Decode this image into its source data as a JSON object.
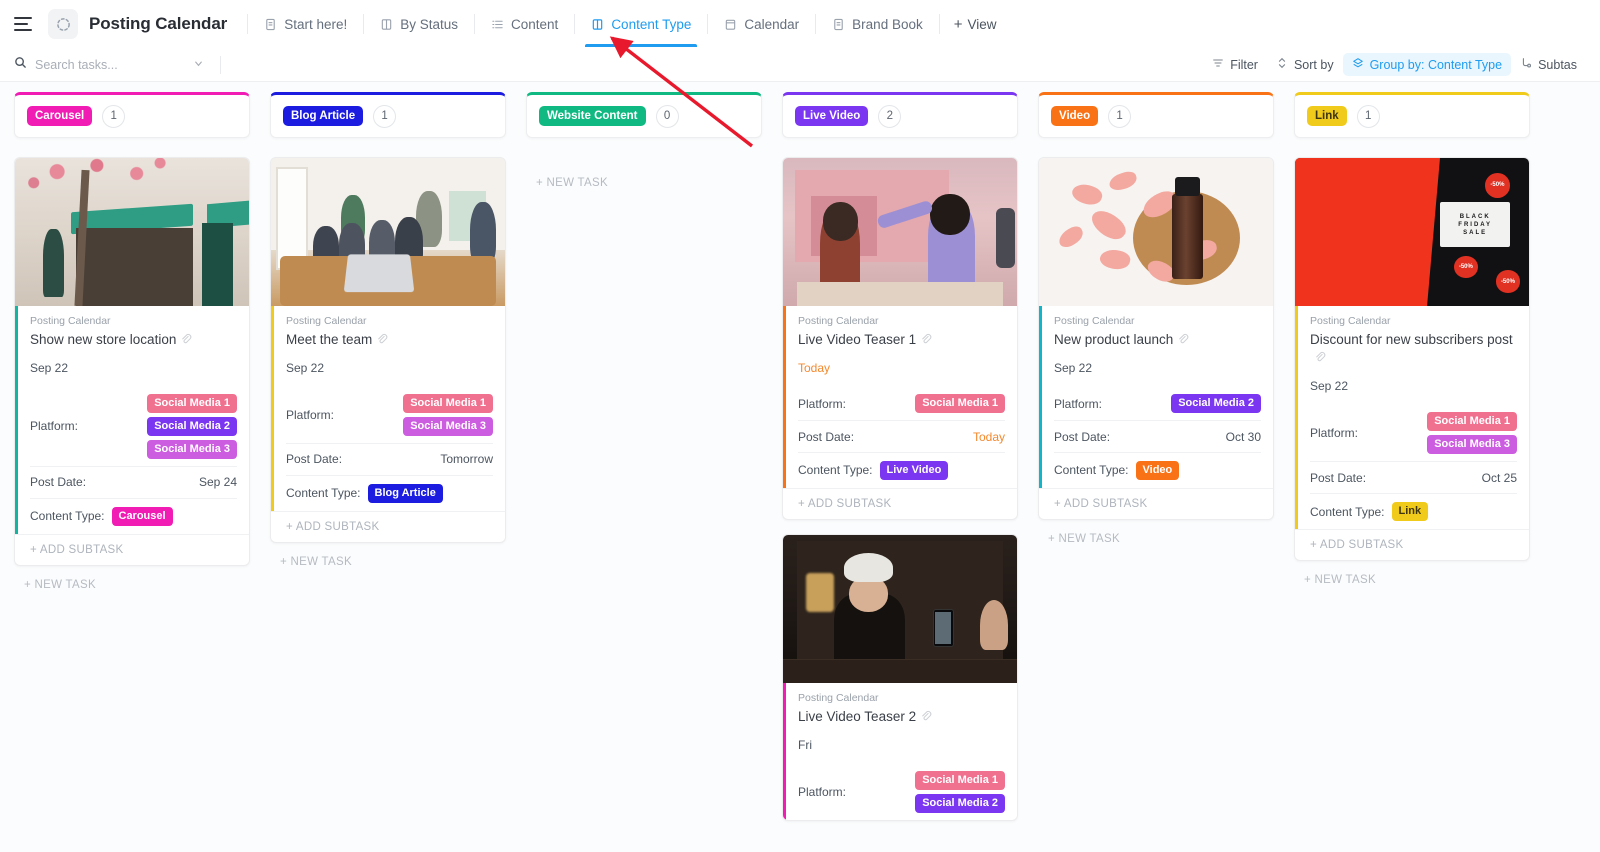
{
  "topbar": {
    "app_title": "Posting Calendar",
    "tabs": [
      {
        "label": "Start here!",
        "icon": "doc-icon",
        "active": false
      },
      {
        "label": "By Status",
        "icon": "board-icon",
        "active": false
      },
      {
        "label": "Content",
        "icon": "list-icon",
        "active": false
      },
      {
        "label": "Content Type",
        "icon": "board-icon",
        "active": true
      },
      {
        "label": "Calendar",
        "icon": "calendar-icon",
        "active": false
      },
      {
        "label": "Brand Book",
        "icon": "doc-icon",
        "active": false
      }
    ],
    "add_view_label": "View"
  },
  "toolbar": {
    "search_placeholder": "Search tasks...",
    "filter_label": "Filter",
    "sort_label": "Sort by",
    "group_label": "Group by: Content Type",
    "subtasks_label": "Subtas"
  },
  "labels": {
    "new_task": "+ NEW TASK",
    "add_subtask": "+ ADD SUBTASK",
    "crumb": "Posting Calendar",
    "platform": "Platform:",
    "post_date": "Post Date:",
    "content_type": "Content Type:"
  },
  "colors": {
    "carousel": "#f01cb4",
    "blog_article": "#1b1ce0",
    "website_content": "#10b981",
    "live_video": "#7a36f0",
    "video": "#f97316",
    "link": "#f0cb1c",
    "social_media_1": "#f0708f",
    "social_media_2": "#7a36f0",
    "social_media_3": "#cc5ce0",
    "accent_active": "#1f9cf0",
    "today": "#f4892e"
  },
  "columns": [
    {
      "type": "Carousel",
      "color": "#f01cb4",
      "count": "1",
      "cards": [
        {
          "cover": "ph-store",
          "accent": "#12b5a0",
          "crumb": "Posting Calendar",
          "title": "Show new store location",
          "date": "Sep 22",
          "date_today": false,
          "platform_label": "Platform:",
          "platforms": [
            {
              "label": "Social Media 1",
              "color": "#f0708f"
            },
            {
              "label": "Social Media 2",
              "color": "#7a36f0"
            },
            {
              "label": "Social Media 3",
              "color": "#cc5ce0"
            }
          ],
          "post_date_label": "Post Date:",
          "post_date": "Sep 24",
          "post_date_today": false,
          "content_type_label": "Content Type:",
          "content_type": "Carousel",
          "content_type_color": "#f01cb4"
        }
      ]
    },
    {
      "type": "Blog Article",
      "color": "#1b1ce0",
      "count": "1",
      "cards": [
        {
          "cover": "ph-team",
          "accent": "#f0cb1c",
          "crumb": "Posting Calendar",
          "title": "Meet the team",
          "date": "Sep 22",
          "date_today": false,
          "platform_label": "Platform:",
          "platforms": [
            {
              "label": "Social Media 1",
              "color": "#f0708f"
            },
            {
              "label": "Social Media 3",
              "color": "#cc5ce0"
            }
          ],
          "post_date_label": "Post Date:",
          "post_date": "Tomorrow",
          "post_date_today": false,
          "content_type_label": "Content Type:",
          "content_type": "Blog Article",
          "content_type_color": "#1b1ce0"
        }
      ]
    },
    {
      "type": "Website Content",
      "color": "#10b981",
      "count": "0",
      "cards": []
    },
    {
      "type": "Live Video",
      "color": "#7a36f0",
      "count": "2",
      "cards": [
        {
          "cover": "ph-makeup",
          "accent": "#f97316",
          "crumb": "Posting Calendar",
          "title": "Live Video Teaser 1",
          "date": "Today",
          "date_today": true,
          "platform_label": "Platform:",
          "platforms": [
            {
              "label": "Social Media 1",
              "color": "#f0708f"
            }
          ],
          "post_date_label": "Post Date:",
          "post_date": "Today",
          "post_date_today": true,
          "content_type_label": "Content Type:",
          "content_type": "Live Video",
          "content_type_color": "#7a36f0"
        },
        {
          "cover": "ph-skin",
          "accent": "#f01cb4",
          "crumb": "Posting Calendar",
          "title": "Live Video Teaser 2",
          "date": "Fri",
          "date_today": false,
          "platform_label": "Platform:",
          "platforms": [
            {
              "label": "Social Media 1",
              "color": "#f0708f"
            },
            {
              "label": "Social Media 2",
              "color": "#7a36f0"
            }
          ],
          "truncated": true
        }
      ]
    },
    {
      "type": "Video",
      "color": "#f97316",
      "count": "1",
      "cards": [
        {
          "cover": "ph-rose",
          "accent": "#12b5c8",
          "crumb": "Posting Calendar",
          "title": "New product launch",
          "date": "Sep 22",
          "date_today": false,
          "platform_label": "Platform:",
          "platforms": [
            {
              "label": "Social Media 2",
              "color": "#7a36f0"
            }
          ],
          "post_date_label": "Post Date:",
          "post_date": "Oct 30",
          "post_date_today": false,
          "content_type_label": "Content Type:",
          "content_type": "Video",
          "content_type_color": "#f97316"
        }
      ]
    },
    {
      "type": "Link",
      "color": "#f0cb1c",
      "count": "1",
      "cards": [
        {
          "cover": "ph-bf",
          "accent": "#f0cb1c",
          "crumb": "Posting Calendar",
          "title": "Discount for new subscribers post",
          "date": "Sep 22",
          "date_today": false,
          "platform_label": "Platform:",
          "platforms": [
            {
              "label": "Social Media 1",
              "color": "#f0708f"
            },
            {
              "label": "Social Media 3",
              "color": "#cc5ce0"
            }
          ],
          "post_date_label": "Post Date:",
          "post_date": "Oct 25",
          "post_date_today": false,
          "content_type_label": "Content Type:",
          "content_type": "Link",
          "content_type_color": "#f0cb1c"
        }
      ]
    }
  ],
  "annotation": {
    "arrow_color": "#e8192c"
  }
}
